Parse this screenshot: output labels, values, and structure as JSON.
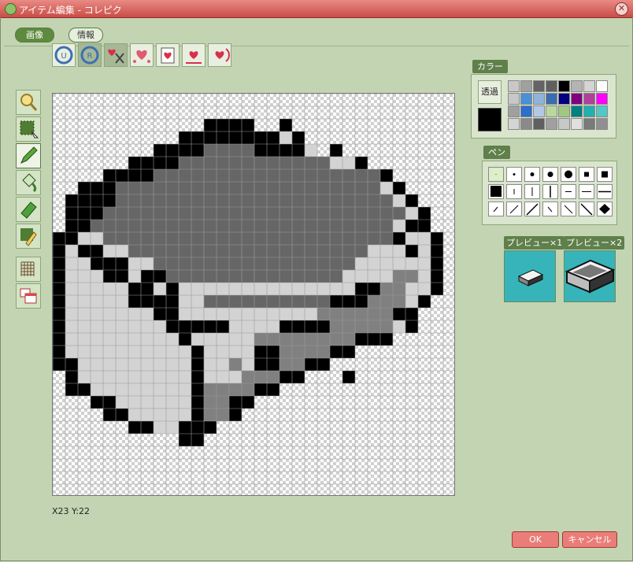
{
  "window": {
    "title": "アイテム編集 - コレピク"
  },
  "tabs": {
    "image": "画像",
    "info": "情報"
  },
  "panels": {
    "color": "カラー",
    "transparent": "透過",
    "pen": "ペン",
    "preview1": "プレビュー×1",
    "preview2": "プレビュー×2"
  },
  "status": {
    "coords": "X23 Y:22"
  },
  "buttons": {
    "ok": "OK",
    "cancel": "キャンセル"
  },
  "palette": [
    "#c8c8c8",
    "#a0a0a0",
    "#646464",
    "#606060",
    "#000000",
    "#b4b4b4",
    "#d4d4d4",
    "#ffffff",
    "#c8c8c8",
    "#4a90d9",
    "#8fb4d9",
    "#3a6db0",
    "#000080",
    "#800080",
    "#b0409a",
    "#ff00ff",
    "#a0a0a0",
    "#2a6fcc",
    "#b4c8e6",
    "#b8d8a0",
    "#a0c880",
    "#008080",
    "#20b0b0",
    "#50c8c8",
    "#d4d4d4",
    "#8a8a8a",
    "#606060",
    "#a0a0a0",
    "#c8c8c8",
    "#e0e0e0",
    "#7a7a7a",
    "#909090"
  ],
  "current_color": "#000000"
}
